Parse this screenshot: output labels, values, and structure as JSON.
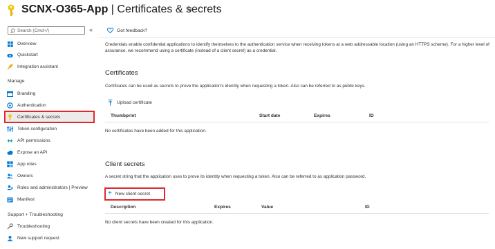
{
  "header": {
    "app_name": "SCNX-O365-App",
    "separator": " | ",
    "page_name": "Certificates & secrets",
    "more": "···"
  },
  "sidebar": {
    "search_placeholder": "Search (Cmd+/)",
    "collapse": "«",
    "items": [
      {
        "label": "Overview",
        "icon": "grid-icon"
      },
      {
        "label": "Quickstart",
        "icon": "cloud-bolt-icon"
      },
      {
        "label": "Integration assistant",
        "icon": "rocket-icon"
      }
    ],
    "manage_title": "Manage",
    "manage_items": [
      {
        "label": "Branding",
        "icon": "branding-icon"
      },
      {
        "label": "Authentication",
        "icon": "auth-icon"
      },
      {
        "label": "Certificates & secrets",
        "icon": "key-icon"
      },
      {
        "label": "Token configuration",
        "icon": "token-config-icon"
      },
      {
        "label": "API permissions",
        "icon": "api-permissions-icon"
      },
      {
        "label": "Expose an API",
        "icon": "cloud-icon"
      },
      {
        "label": "App roles",
        "icon": "app-roles-icon"
      },
      {
        "label": "Owners",
        "icon": "owners-icon"
      },
      {
        "label": "Roles and administrators | Preview",
        "icon": "roles-icon"
      },
      {
        "label": "Manifest",
        "icon": "manifest-icon"
      }
    ],
    "support_title": "Support + Troubleshooting",
    "support_items": [
      {
        "label": "Troubleshooting",
        "icon": "wrench-icon"
      },
      {
        "label": "New support request",
        "icon": "support-icon"
      }
    ]
  },
  "main": {
    "feedback_label": "Got feedback?",
    "intro": "Credentials enable confidential applications to identify themselves to the authentication service when receiving tokens at a web addressable location (using an HTTPS scheme). For a higher level of assurance, we recommend using a certificate (instead of a client secret) as a credential.",
    "certificates": {
      "title": "Certificates",
      "description": "Certificates can be used as secrets to prove the application's identity when requesting a token. Also can be referred to as public keys.",
      "upload_label": "Upload certificate",
      "columns": [
        "Thumbprint",
        "Start date",
        "Expires",
        "ID"
      ],
      "empty_text": "No certificates have been added for this application."
    },
    "client_secrets": {
      "title": "Client secrets",
      "description": "A secret string that the application uses to prove its identity when requesting a token. Also can be referred to as application password.",
      "new_label": "New client secret",
      "columns": [
        "Description",
        "Expires",
        "Value",
        "ID"
      ],
      "empty_text": "No client secrets have been created for this application."
    }
  },
  "colors": {
    "highlight": "#e0282c",
    "accent": "#0078d4"
  }
}
